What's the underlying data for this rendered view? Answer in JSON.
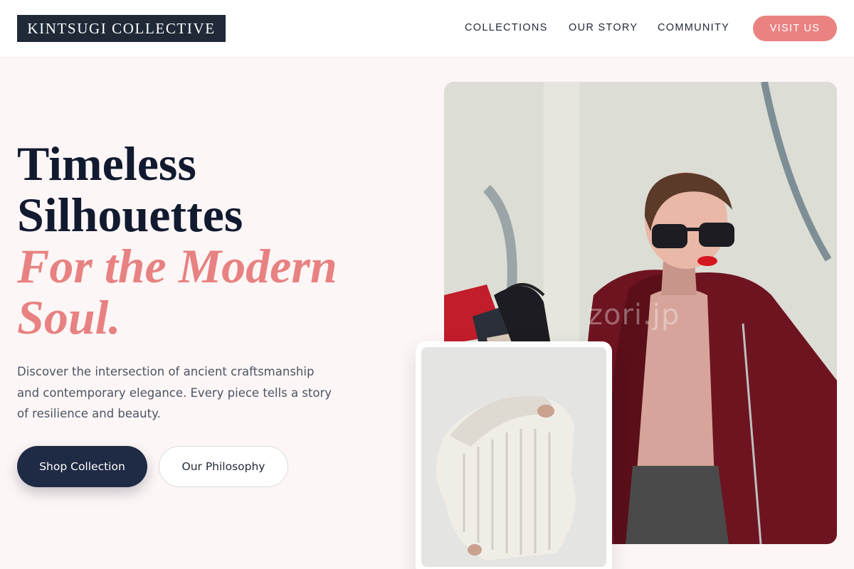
{
  "header": {
    "logo": "KINTSUGI COLLECTIVE",
    "nav": [
      {
        "label": "COLLECTIONS"
      },
      {
        "label": "OUR STORY"
      },
      {
        "label": "COMMUNITY"
      }
    ],
    "cta_label": "VISIT US"
  },
  "hero": {
    "headline_lines": [
      "Timeless",
      "Silhouettes"
    ],
    "accent_lines": [
      "For the Modern",
      "Soul."
    ],
    "description": "Discover the intersection of ancient craftsmanship and contemporary elegance. Every piece tells a story of resilience and beauty.",
    "primary_button": "Shop Collection",
    "secondary_button": "Our Philosophy"
  },
  "images": {
    "main_watermark": "zori.jp"
  },
  "colors": {
    "accent": "#ea8282",
    "dark": "#1f2a44",
    "background": "#fdf6f6"
  }
}
